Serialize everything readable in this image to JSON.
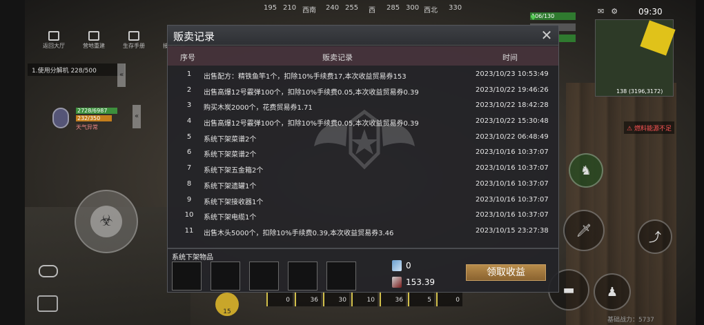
{
  "hud": {
    "compass": [
      "195",
      "210",
      "西南",
      "240",
      "255",
      "西",
      "285",
      "300",
      "西北",
      "330"
    ],
    "top_nav": [
      {
        "label": "返回大厅"
      },
      {
        "label": "营地重建"
      },
      {
        "label": "生存手册"
      },
      {
        "label": "接头报酬"
      }
    ],
    "task": "1.使用分解机 228/500",
    "player": {
      "hp": "2728/6987",
      "mp": "232/350",
      "name": "天气异常"
    },
    "stats": {
      "health": "106/130",
      "stat2": "500",
      "stat3": "500"
    },
    "clock": "09:30",
    "map_coords": "138\n(3196,3172)",
    "warning": "燃料能源不足",
    "bottom_status": "基础战力：5737",
    "ammo": "15",
    "hotbar": [
      "0",
      "36",
      "30",
      "10",
      "36",
      "5",
      "0"
    ]
  },
  "dialog": {
    "title": "贩卖记录",
    "columns": {
      "index": "序号",
      "record": "贩卖记录",
      "time": "时间"
    },
    "rows": [
      {
        "index": "1",
        "record": "出售配方：精铁鱼竿1个，扣除10%手续费17,本次收益贸易券153",
        "time": "2023/10/23 10:53:49"
      },
      {
        "index": "2",
        "record": "出售高爆12号霰弹100个，扣除10%手续费0.05,本次收益贸易券0.39",
        "time": "2023/10/22 19:46:26"
      },
      {
        "index": "3",
        "record": "购买木炭2000个，花费贸易券1.71",
        "time": "2023/10/22 18:42:28"
      },
      {
        "index": "4",
        "record": "出售高爆12号霰弹100个，扣除10%手续费0.05,本次收益贸易券0.39",
        "time": "2023/10/22 15:30:48"
      },
      {
        "index": "5",
        "record": "系统下架菜谱2个",
        "time": "2023/10/22 06:48:49"
      },
      {
        "index": "6",
        "record": "系统下架菜谱2个",
        "time": "2023/10/16 10:37:07"
      },
      {
        "index": "7",
        "record": "系统下架五金箱2个",
        "time": "2023/10/16 10:37:07"
      },
      {
        "index": "8",
        "record": "系统下架遗罐1个",
        "time": "2023/10/16 10:37:07"
      },
      {
        "index": "9",
        "record": "系统下架接收器1个",
        "time": "2023/10/16 10:37:07"
      },
      {
        "index": "10",
        "record": "系统下架电缆1个",
        "time": "2023/10/16 10:37:07"
      },
      {
        "index": "11",
        "record": "出售木头5000个，扣除10%手续费0.39,本次收益贸易券3.46",
        "time": "2023/10/15 23:27:38"
      }
    ],
    "footer": {
      "label": "系统下架物品",
      "currency_1": "0",
      "currency_2": "153.39",
      "claim_button": "领取收益"
    }
  },
  "colors": {
    "accent_button": "#a57a3d",
    "header_row": "#48343c",
    "health_green": "#2f7a2f"
  }
}
